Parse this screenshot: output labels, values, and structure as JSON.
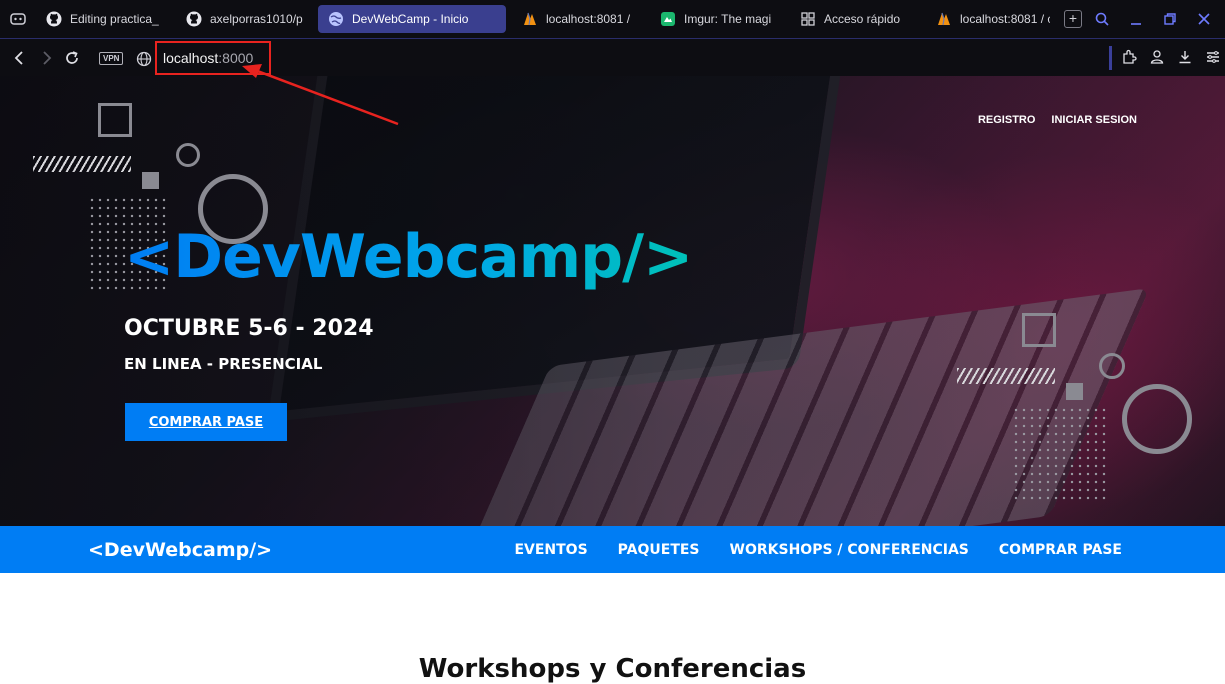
{
  "browser": {
    "tabs": [
      {
        "label": "Editing practica_",
        "icon": "github-icon",
        "active": false
      },
      {
        "label": "axelporras1010/p",
        "icon": "github-icon",
        "active": false
      },
      {
        "label": "DevWebCamp - Inicio",
        "icon": "globe-icon",
        "active": true
      },
      {
        "label": "localhost:8081 /",
        "icon": "phpmyadmin-icon",
        "active": false
      },
      {
        "label": "Imgur: The magi",
        "icon": "imgur-icon",
        "active": false
      },
      {
        "label": "Acceso rápido",
        "icon": "grid-icon",
        "active": false
      },
      {
        "label": "localhost:8081 / c",
        "icon": "phpmyadmin-icon",
        "active": false
      }
    ],
    "new_tab_label": "+",
    "vpn_label": "VPN",
    "url_host": "localhost",
    "url_port": ":8000"
  },
  "hero": {
    "nav": {
      "register": "REGISTRO",
      "login": "INICIAR SESION"
    },
    "logo": "<DevWebcamp/>",
    "date": "OCTUBRE 5-6 - 2024",
    "mode": "EN LINEA - PRESENCIAL",
    "cta": "COMPRAR PASE"
  },
  "navbar": {
    "logo": "<DevWebcamp/>",
    "links": [
      "EVENTOS",
      "PAQUETES",
      "WORKSHOPS / CONFERENCIAS",
      "COMPRAR PASE"
    ]
  },
  "content": {
    "title": "Workshops y Conferencias"
  },
  "colors": {
    "brand_blue": "#007df4",
    "accent_teal": "#00c2b8",
    "annotation_red": "#e8231f",
    "chrome_bg": "#0d0d12",
    "active_tab": "#3a3f8f"
  }
}
